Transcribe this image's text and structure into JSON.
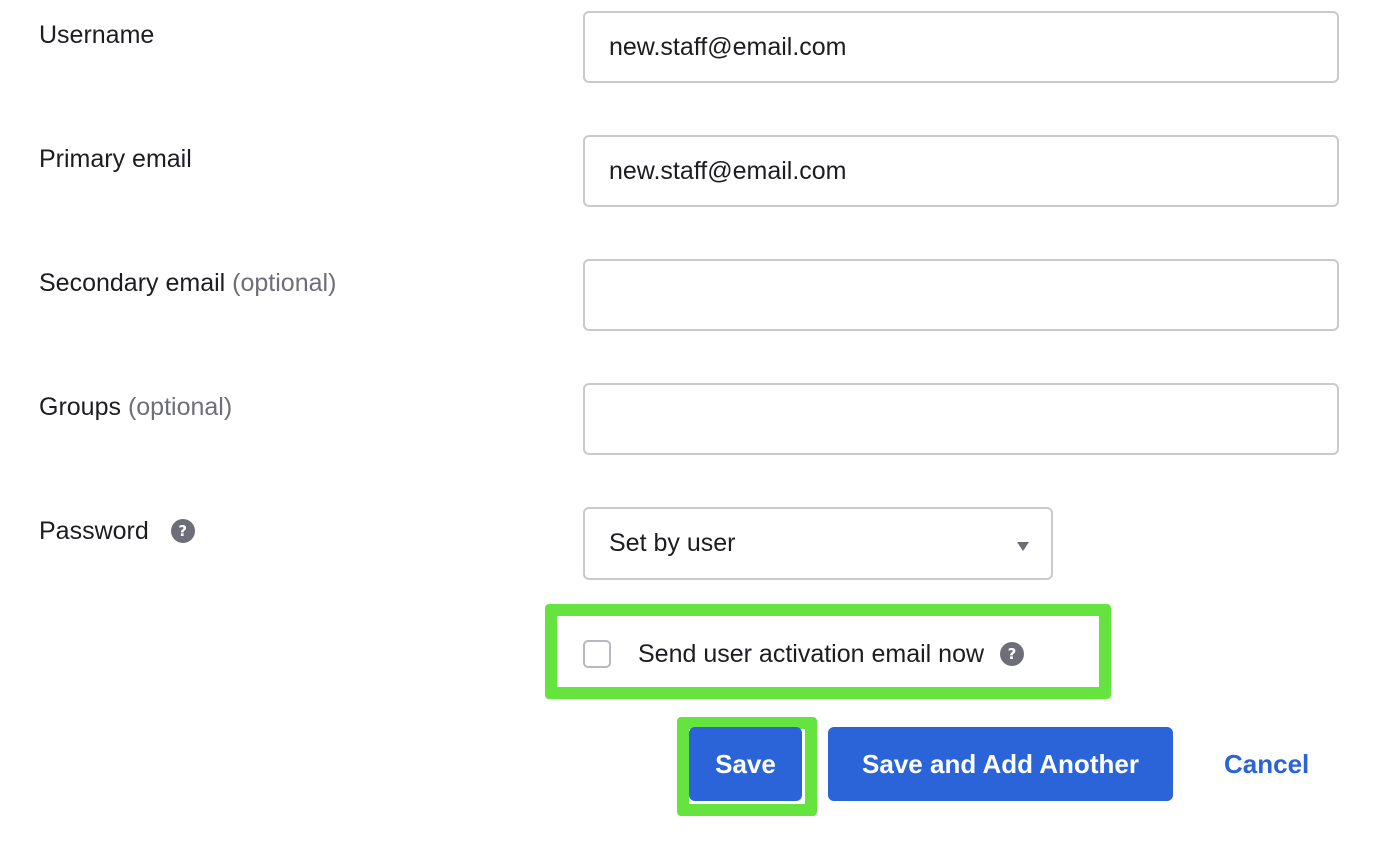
{
  "form": {
    "username": {
      "label": "Username",
      "value": "new.staff@email.com"
    },
    "primary_email": {
      "label": "Primary email",
      "value": "new.staff@email.com"
    },
    "secondary_email": {
      "label": "Secondary email",
      "optional": "(optional)",
      "value": ""
    },
    "groups": {
      "label": "Groups",
      "optional": "(optional)",
      "value": ""
    },
    "password": {
      "label": "Password",
      "help_glyph": "?",
      "selected": "Set by user"
    },
    "activation": {
      "label": "Send user activation email now",
      "checked": false,
      "help_glyph": "?"
    }
  },
  "actions": {
    "save_label": "Save",
    "save_add_label": "Save and Add Another",
    "cancel_label": "Cancel"
  },
  "colors": {
    "primary": "#2b63d8",
    "highlight": "#65e33f",
    "border": "#c9c9ce",
    "muted_text": "#6e6e78"
  },
  "icons": {
    "help": "question-circle-icon",
    "select_arrow": "caret-down-icon"
  }
}
